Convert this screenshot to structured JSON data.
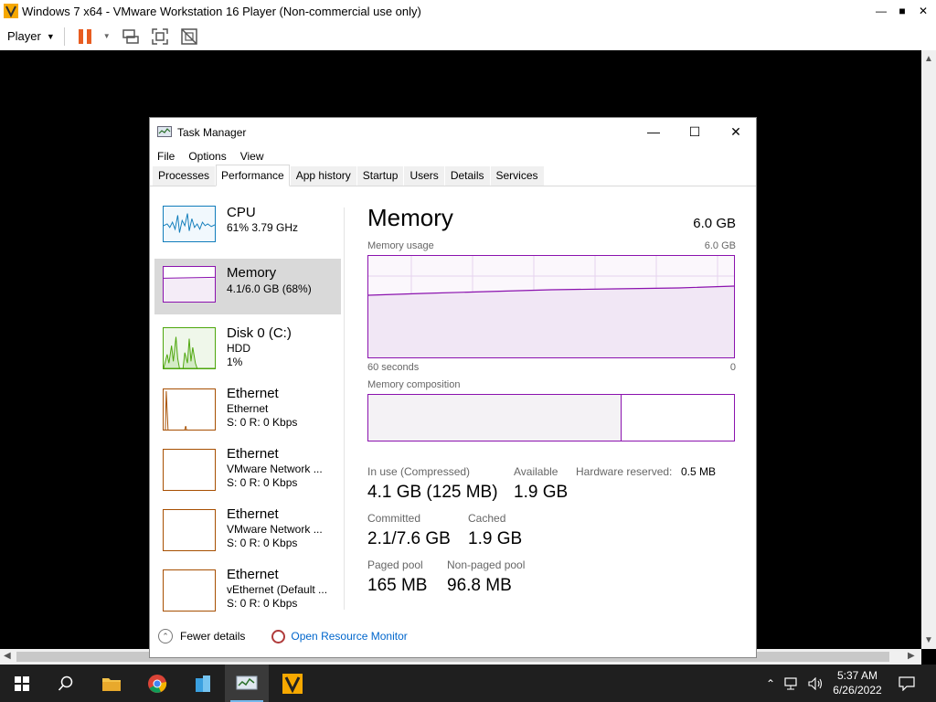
{
  "vm": {
    "title": "Windows 7 x64 - VMware Workstation 16 Player (Non-commercial use only)",
    "player_menu": "Player",
    "collapse_label": "<<"
  },
  "taskmanager": {
    "title": "Task Manager",
    "menu": [
      "File",
      "Options",
      "View"
    ],
    "tabs": [
      "Processes",
      "Performance",
      "App history",
      "Startup",
      "Users",
      "Details",
      "Services"
    ],
    "active_tab": "Performance",
    "resources": [
      {
        "name": "CPU",
        "sub1": "61%  3.79 GHz",
        "sub2": "",
        "sub3": "",
        "color": "#117dbb"
      },
      {
        "name": "Memory",
        "sub1": "4.1/6.0 GB (68%)",
        "sub2": "",
        "sub3": "",
        "color": "#8b12ae"
      },
      {
        "name": "Disk 0 (C:)",
        "sub1": "HDD",
        "sub2": "1%",
        "sub3": "",
        "color": "#4da60c"
      },
      {
        "name": "Ethernet",
        "sub1": "Ethernet",
        "sub2": "S: 0  R: 0 Kbps",
        "sub3": "",
        "color": "#a74f01"
      },
      {
        "name": "Ethernet",
        "sub1": "VMware Network ...",
        "sub2": "S: 0  R: 0 Kbps",
        "sub3": "",
        "color": "#a74f01"
      },
      {
        "name": "Ethernet",
        "sub1": "VMware Network ...",
        "sub2": "S: 0  R: 0 Kbps",
        "sub3": "",
        "color": "#a74f01"
      },
      {
        "name": "Ethernet",
        "sub1": "vEthernet (Default ...",
        "sub2": "S: 0  R: 0 Kbps",
        "sub3": "",
        "color": "#a74f01"
      }
    ],
    "memory": {
      "title": "Memory",
      "total": "6.0 GB",
      "usage_label": "Memory usage",
      "usage_max": "6.0 GB",
      "time_left": "60 seconds",
      "time_right": "0",
      "composition_label": "Memory composition",
      "in_use_fraction": 0.69,
      "stats": {
        "in_use_label": "In use (Compressed)",
        "in_use_value": "4.1 GB (125 MB)",
        "available_label": "Available",
        "available_value": "1.9 GB",
        "hw_reserved_label": "Hardware reserved:",
        "hw_reserved_value": "0.5 MB",
        "committed_label": "Committed",
        "committed_value": "2.1/7.6 GB",
        "cached_label": "Cached",
        "cached_value": "1.9 GB",
        "paged_label": "Paged pool",
        "paged_value": "165 MB",
        "nonpaged_label": "Non-paged pool",
        "nonpaged_value": "96.8 MB"
      }
    },
    "footer": {
      "fewer_details": "Fewer details",
      "open_resource_monitor": "Open Resource Monitor"
    }
  },
  "taskbar": {
    "time": "5:37 AM",
    "date": "6/26/2022",
    "icons": [
      "windows-start-icon",
      "search-icon",
      "file-explorer-icon",
      "chrome-icon",
      "app-icon",
      "task-manager-icon",
      "vmware-icon"
    ]
  },
  "colors": {
    "memory": "#8b12ae",
    "cpu": "#117dbb",
    "disk": "#4da60c",
    "ethernet": "#a74f01"
  }
}
